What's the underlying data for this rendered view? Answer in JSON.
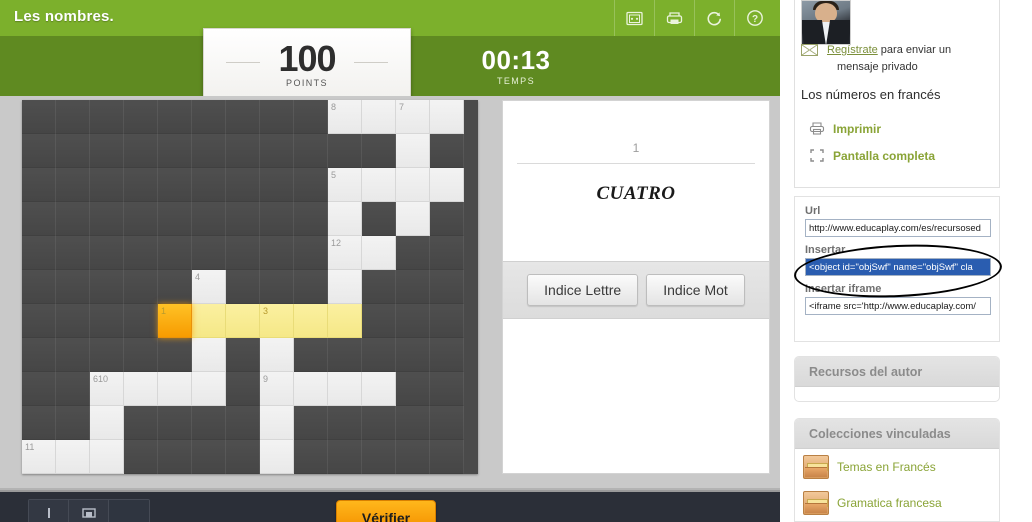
{
  "game": {
    "title": "Les nombres.",
    "header_icons": [
      {
        "name": "fullscreen-monitor-icon",
        "glyph": "monitor"
      },
      {
        "name": "printer-icon",
        "glyph": "printer"
      },
      {
        "name": "restart-icon",
        "glyph": "refresh"
      },
      {
        "name": "help-icon",
        "glyph": "question"
      }
    ],
    "score": {
      "value": "100",
      "label": "POINTS"
    },
    "time": {
      "value": "00:13",
      "label": "TEMPS"
    },
    "clue": {
      "number": "1",
      "text": "CUATRO",
      "hint_letter_button": "Indice Lettre",
      "hint_word_button": "Indice Mot"
    },
    "footer": {
      "verify_button": "Vérifier",
      "tools": [
        "keyboard-tool",
        "save-tool",
        "extra-tool"
      ]
    },
    "grid": {
      "cols": 13,
      "rows": 11,
      "cells": [
        [
          {
            "t": "block"
          },
          {
            "t": "block"
          },
          {
            "t": "block"
          },
          {
            "t": "block"
          },
          {
            "t": "block"
          },
          {
            "t": "block"
          },
          {
            "t": "block"
          },
          {
            "t": "block"
          },
          {
            "t": "block"
          },
          {
            "t": "open",
            "n": "8"
          },
          {
            "t": "open"
          },
          {
            "t": "open",
            "n": "7"
          },
          {
            "t": "open"
          }
        ],
        [
          {
            "t": "block"
          },
          {
            "t": "block"
          },
          {
            "t": "block"
          },
          {
            "t": "block"
          },
          {
            "t": "block"
          },
          {
            "t": "block"
          },
          {
            "t": "block"
          },
          {
            "t": "block"
          },
          {
            "t": "block"
          },
          {
            "t": "block"
          },
          {
            "t": "block"
          },
          {
            "t": "open"
          },
          {
            "t": "block"
          }
        ],
        [
          {
            "t": "block"
          },
          {
            "t": "block"
          },
          {
            "t": "block"
          },
          {
            "t": "block"
          },
          {
            "t": "block"
          },
          {
            "t": "block"
          },
          {
            "t": "block"
          },
          {
            "t": "block"
          },
          {
            "t": "block"
          },
          {
            "t": "open",
            "n": "5"
          },
          {
            "t": "open"
          },
          {
            "t": "open"
          },
          {
            "t": "open"
          }
        ],
        [
          {
            "t": "block"
          },
          {
            "t": "block"
          },
          {
            "t": "block"
          },
          {
            "t": "block"
          },
          {
            "t": "block"
          },
          {
            "t": "block"
          },
          {
            "t": "block"
          },
          {
            "t": "block"
          },
          {
            "t": "block"
          },
          {
            "t": "open"
          },
          {
            "t": "block"
          },
          {
            "t": "open"
          },
          {
            "t": "block"
          }
        ],
        [
          {
            "t": "block"
          },
          {
            "t": "block"
          },
          {
            "t": "block"
          },
          {
            "t": "block"
          },
          {
            "t": "block"
          },
          {
            "t": "block"
          },
          {
            "t": "block"
          },
          {
            "t": "block"
          },
          {
            "t": "block"
          },
          {
            "t": "open",
            "n": "12"
          },
          {
            "t": "open"
          },
          {
            "t": "block"
          },
          {
            "t": "block"
          }
        ],
        [
          {
            "t": "block"
          },
          {
            "t": "block"
          },
          {
            "t": "block"
          },
          {
            "t": "block"
          },
          {
            "t": "block"
          },
          {
            "t": "open",
            "n": "4"
          },
          {
            "t": "block"
          },
          {
            "t": "block"
          },
          {
            "t": "block"
          },
          {
            "t": "open"
          },
          {
            "t": "block"
          },
          {
            "t": "block"
          },
          {
            "t": "block"
          }
        ],
        [
          {
            "t": "block"
          },
          {
            "t": "block"
          },
          {
            "t": "block"
          },
          {
            "t": "block"
          },
          {
            "t": "active",
            "n": "1"
          },
          {
            "t": "hl"
          },
          {
            "t": "hl"
          },
          {
            "t": "hl",
            "n": "3"
          },
          {
            "t": "hl"
          },
          {
            "t": "hl"
          },
          {
            "t": "block"
          },
          {
            "t": "block"
          },
          {
            "t": "block"
          }
        ],
        [
          {
            "t": "block"
          },
          {
            "t": "block"
          },
          {
            "t": "block"
          },
          {
            "t": "block"
          },
          {
            "t": "block"
          },
          {
            "t": "open"
          },
          {
            "t": "block"
          },
          {
            "t": "open"
          },
          {
            "t": "block"
          },
          {
            "t": "block"
          },
          {
            "t": "block"
          },
          {
            "t": "block"
          },
          {
            "t": "block"
          }
        ],
        [
          {
            "t": "block"
          },
          {
            "t": "block"
          },
          {
            "t": "open",
            "n": "610"
          },
          {
            "t": "open"
          },
          {
            "t": "open"
          },
          {
            "t": "open"
          },
          {
            "t": "block"
          },
          {
            "t": "open",
            "n": "9"
          },
          {
            "t": "open"
          },
          {
            "t": "open"
          },
          {
            "t": "open"
          },
          {
            "t": "block"
          },
          {
            "t": "block"
          }
        ],
        [
          {
            "t": "block"
          },
          {
            "t": "block"
          },
          {
            "t": "open"
          },
          {
            "t": "block"
          },
          {
            "t": "block"
          },
          {
            "t": "block"
          },
          {
            "t": "block"
          },
          {
            "t": "open"
          },
          {
            "t": "block"
          },
          {
            "t": "block"
          },
          {
            "t": "block"
          },
          {
            "t": "block"
          },
          {
            "t": "block"
          }
        ],
        [
          {
            "t": "open",
            "n": "11"
          },
          {
            "t": "open"
          },
          {
            "t": "open"
          },
          {
            "t": "block"
          },
          {
            "t": "block"
          },
          {
            "t": "block"
          },
          {
            "t": "block"
          },
          {
            "t": "open"
          },
          {
            "t": "block"
          },
          {
            "t": "block"
          },
          {
            "t": "block"
          },
          {
            "t": "block"
          },
          {
            "t": "block"
          }
        ]
      ]
    }
  },
  "sidebar": {
    "message": {
      "link": "Regístrate",
      "line1_rest": " para enviar un",
      "line2": "mensaje privado"
    },
    "resource_title": "Los números en francés",
    "actions": [
      {
        "name": "print-action",
        "label": "Imprimir",
        "icon": "printer-icon"
      },
      {
        "name": "fullscreen-action",
        "label": "Pantalla completa",
        "icon": "expand-icon"
      }
    ],
    "embed": {
      "url_label": "Url",
      "url_value": "http://www.educaplay.com/es/recursosed",
      "object_label": "Insertar",
      "object_value": "<object id=\"objSwf\" name=\"objSwf\" cla",
      "iframe_label": "Insertar iframe",
      "iframe_value": "<iframe src='http://www.educaplay.com/"
    },
    "panels": [
      {
        "name": "author-resources-panel",
        "title": "Recursos del autor"
      },
      {
        "name": "linked-collections-panel",
        "title": "Colecciones vinculadas"
      }
    ],
    "collections": [
      {
        "label": "Temas en Francés"
      },
      {
        "label": "Gramatica francesa"
      }
    ]
  },
  "colors": {
    "brand_green": "#7cb02c",
    "brand_green_dark": "#5f8a21",
    "active_cell": "#f79b00",
    "highlight_cell": "#f5e887",
    "link_green": "#8aa437",
    "verify_orange": "#f59200"
  }
}
